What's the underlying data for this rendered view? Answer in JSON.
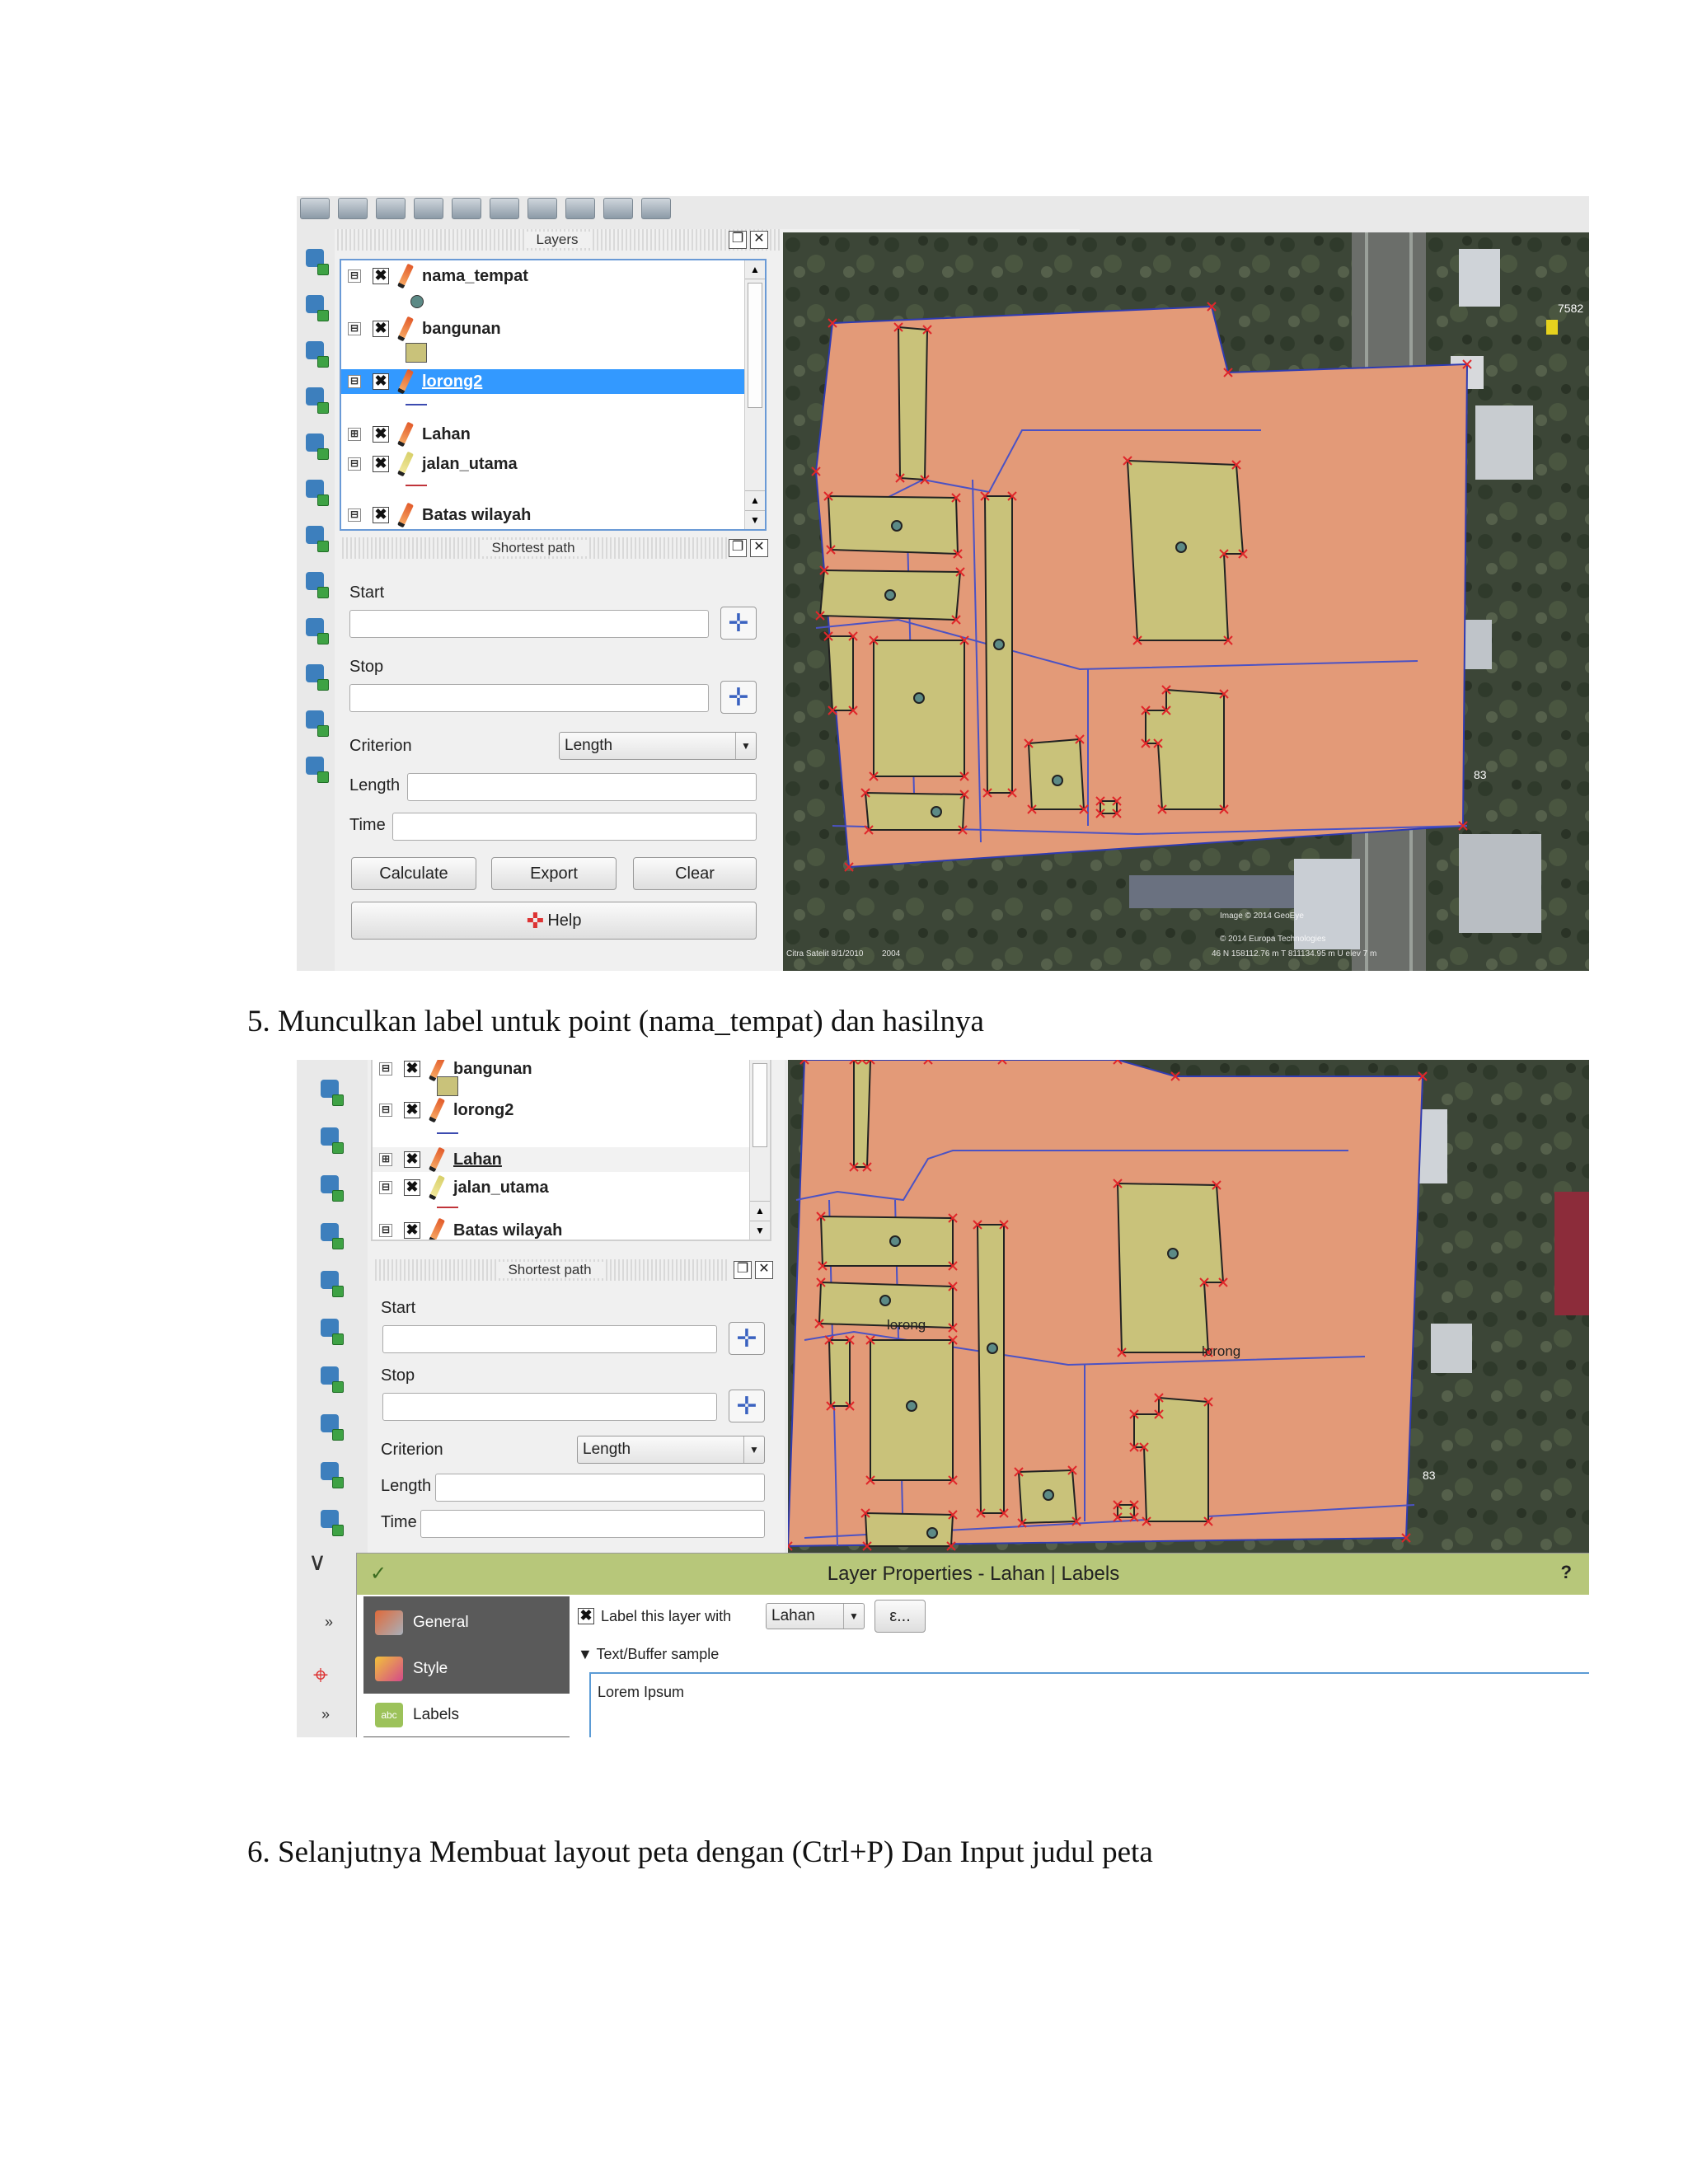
{
  "document": {
    "step5": "5.   Munculkan label untuk point (nama_tempat) dan hasilnya",
    "step6": "6.    Selanjutnya Membuat layout peta dengan (Ctrl+P) Dan Input judul peta"
  },
  "screenshot1": {
    "layers_panel": {
      "title": "Layers",
      "layers": [
        {
          "name": "nama_tempat",
          "checked": "✖",
          "expander": "⊟"
        },
        {
          "name": "bangunan",
          "checked": "✖",
          "expander": "⊟"
        },
        {
          "name": "lorong2",
          "checked": "✖",
          "expander": "⊟",
          "selected": true
        },
        {
          "name": "Lahan",
          "checked": "✖",
          "expander": "⊞"
        },
        {
          "name": "jalan_utama",
          "checked": "✖",
          "expander": "⊟"
        },
        {
          "name": "Batas wilayah",
          "checked": "✖",
          "expander": "⊟"
        }
      ]
    },
    "shortest_path": {
      "title": "Shortest path",
      "start_label": "Start",
      "stop_label": "Stop",
      "criterion_label": "Criterion",
      "criterion_value": "Length",
      "length_label": "Length",
      "time_label": "Time",
      "calculate_label": "Calculate",
      "export_label": "Export",
      "clear_label": "Clear",
      "help_label": "Help"
    },
    "map": {
      "side_number": "83",
      "pin_number": "7582",
      "copyright_1": "Image © 2014 GeoEye",
      "copyright_2": "© 2014 Europa Technologies",
      "coords": "46 N 158112.76 m T 811134.95 m U elev 7 m",
      "date": "Citra Satelit 8/1/2010",
      "year": "2004"
    }
  },
  "screenshot2": {
    "layers_panel": {
      "layers": [
        {
          "name": "bangunan",
          "checked": "✖",
          "expander": "⊟"
        },
        {
          "name": "lorong2",
          "checked": "✖",
          "expander": "⊟"
        },
        {
          "name": "Lahan",
          "checked": "✖",
          "expander": "⊞"
        },
        {
          "name": "jalan_utama",
          "checked": "✖",
          "expander": "⊟"
        },
        {
          "name": "Batas wilayah",
          "checked": "✖",
          "expander": "⊟"
        }
      ]
    },
    "shortest_path": {
      "title": "Shortest path",
      "start_label": "Start",
      "stop_label": "Stop",
      "criterion_label": "Criterion",
      "criterion_value": "Length",
      "length_label": "Length",
      "time_label": "Time"
    },
    "map": {
      "labels": [
        "lorong",
        "lorong"
      ],
      "side_number": "83"
    },
    "layer_properties": {
      "title": "Layer Properties - Lahan | Labels",
      "help": "?",
      "nav": [
        "General",
        "Style",
        "Labels"
      ],
      "label_this_layer_with": "Label this layer with",
      "label_field": "Lahan",
      "expression_button": "ε...",
      "text_buffer_sample": "Text/Buffer sample",
      "sample_text": "Lorem Ipsum"
    }
  },
  "colors": {
    "parcel_fill": "#e39a78",
    "building_fill": "#c9c27a",
    "road_line": "#4b52c4",
    "vertex_marker": "#e0262a",
    "selection": "#3399ff",
    "dialog_title": "#b7c77a"
  }
}
